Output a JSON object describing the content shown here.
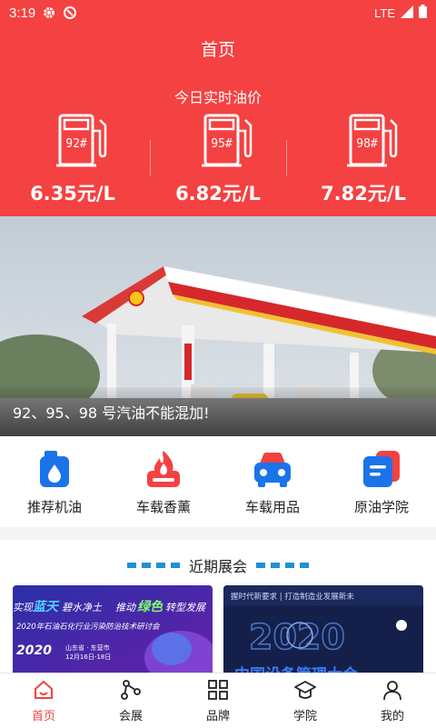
{
  "status_bar": {
    "time": "3:19",
    "network": "LTE"
  },
  "header": {
    "title": "首页",
    "subtitle": "今日实时油价",
    "prices": [
      {
        "grade": "92#",
        "price": "6.35元/L"
      },
      {
        "grade": "95#",
        "price": "6.82元/L"
      },
      {
        "grade": "98#",
        "price": "7.82元/L"
      }
    ]
  },
  "banner": {
    "caption": "92、95、98 号汽油不能混加!"
  },
  "quick_links": [
    {
      "label": "推荐机油",
      "icon": "oil-can-icon"
    },
    {
      "label": "车载香薰",
      "icon": "flame-icon"
    },
    {
      "label": "车载用品",
      "icon": "car-icon"
    },
    {
      "label": "原油学院",
      "icon": "book-icon"
    }
  ],
  "events": {
    "title": "近期展会",
    "cards": [
      {
        "headline_a": "实现",
        "headline_b": "蓝天",
        "headline_c": "碧水净土",
        "headline_d": "推动",
        "headline_e": "绿色",
        "headline_f": "转型发展",
        "subtitle": "2020年石油石化行业污染防治技术研讨会",
        "year": "2020",
        "location": "山东省 · 东营市",
        "dates": "12月16日-18日"
      },
      {
        "top_text": "握时代新要求 | 打造制造业发展新未",
        "year": "2020",
        "bottom_text": "中国设备管理大会"
      }
    ]
  },
  "tabbar": {
    "tabs": [
      {
        "label": "首页",
        "active": true
      },
      {
        "label": "会展",
        "active": false
      },
      {
        "label": "品牌",
        "active": false
      },
      {
        "label": "学院",
        "active": false
      },
      {
        "label": "我的",
        "active": false
      }
    ]
  },
  "colors": {
    "primary": "#f44141",
    "accent_blue": "#1e90d6",
    "card_blue": "#1a73e8"
  }
}
